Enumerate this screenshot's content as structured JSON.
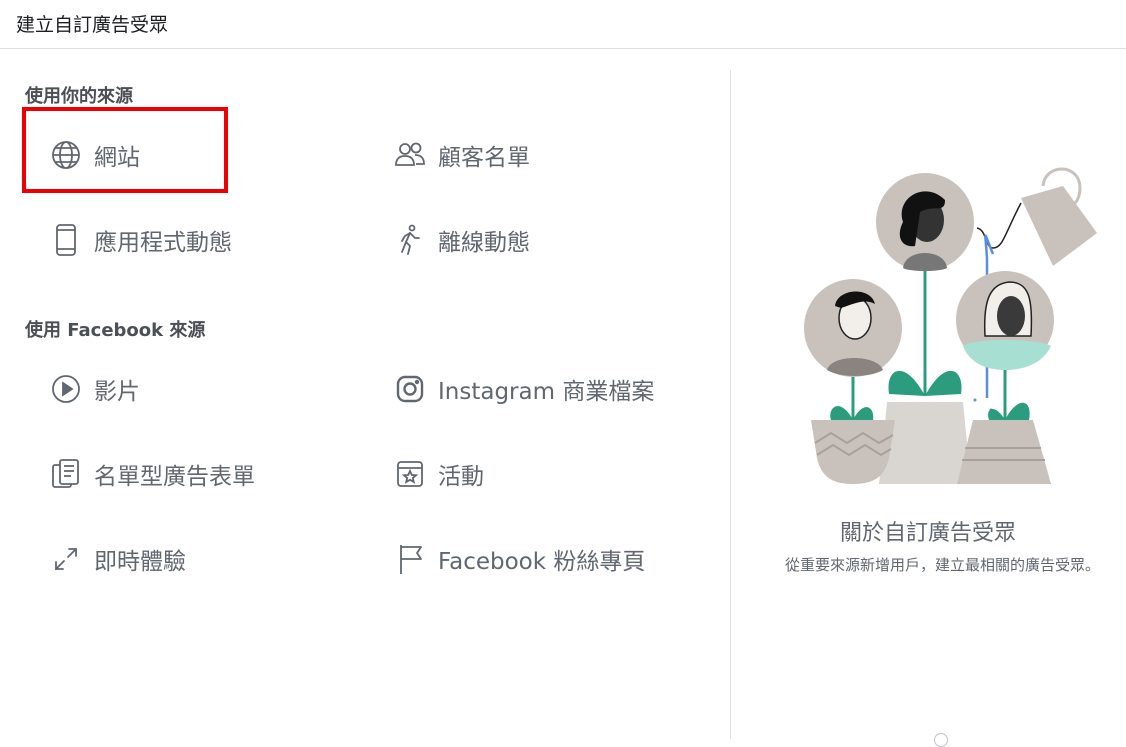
{
  "header": {
    "title": "建立自訂廣告受眾"
  },
  "sections": {
    "own_sources": {
      "title": "使用你的來源"
    },
    "facebook_sources": {
      "title": "使用 Facebook 來源"
    }
  },
  "options": {
    "website": {
      "label": "網站",
      "icon": "globe-icon"
    },
    "customer_list": {
      "label": "顧客名單",
      "icon": "people-icon"
    },
    "app_activity": {
      "label": "應用程式動態",
      "icon": "mobile-phone-icon"
    },
    "offline_activity": {
      "label": "離線動態",
      "icon": "walking-person-icon"
    },
    "video": {
      "label": "影片",
      "icon": "play-icon"
    },
    "instagram": {
      "label": "Instagram 商業檔案",
      "icon": "instagram-icon"
    },
    "lead_form": {
      "label": "名單型廣告表單",
      "icon": "form-icon"
    },
    "events": {
      "label": "活動",
      "icon": "event-star-icon"
    },
    "instant_experience": {
      "label": "即時體驗",
      "icon": "expand-arrows-icon"
    },
    "facebook_page": {
      "label": "Facebook 粉絲專頁",
      "icon": "flag-icon"
    }
  },
  "about": {
    "title": "關於自訂廣告受眾",
    "description": "從重要來源新增用戶，建立最相關的廣告受眾。"
  },
  "colors": {
    "highlight": "#ee0000",
    "icon": "#606770",
    "label": "#606770",
    "leaf_green": "#2c9c7e",
    "pot": "#c9c2bc"
  }
}
